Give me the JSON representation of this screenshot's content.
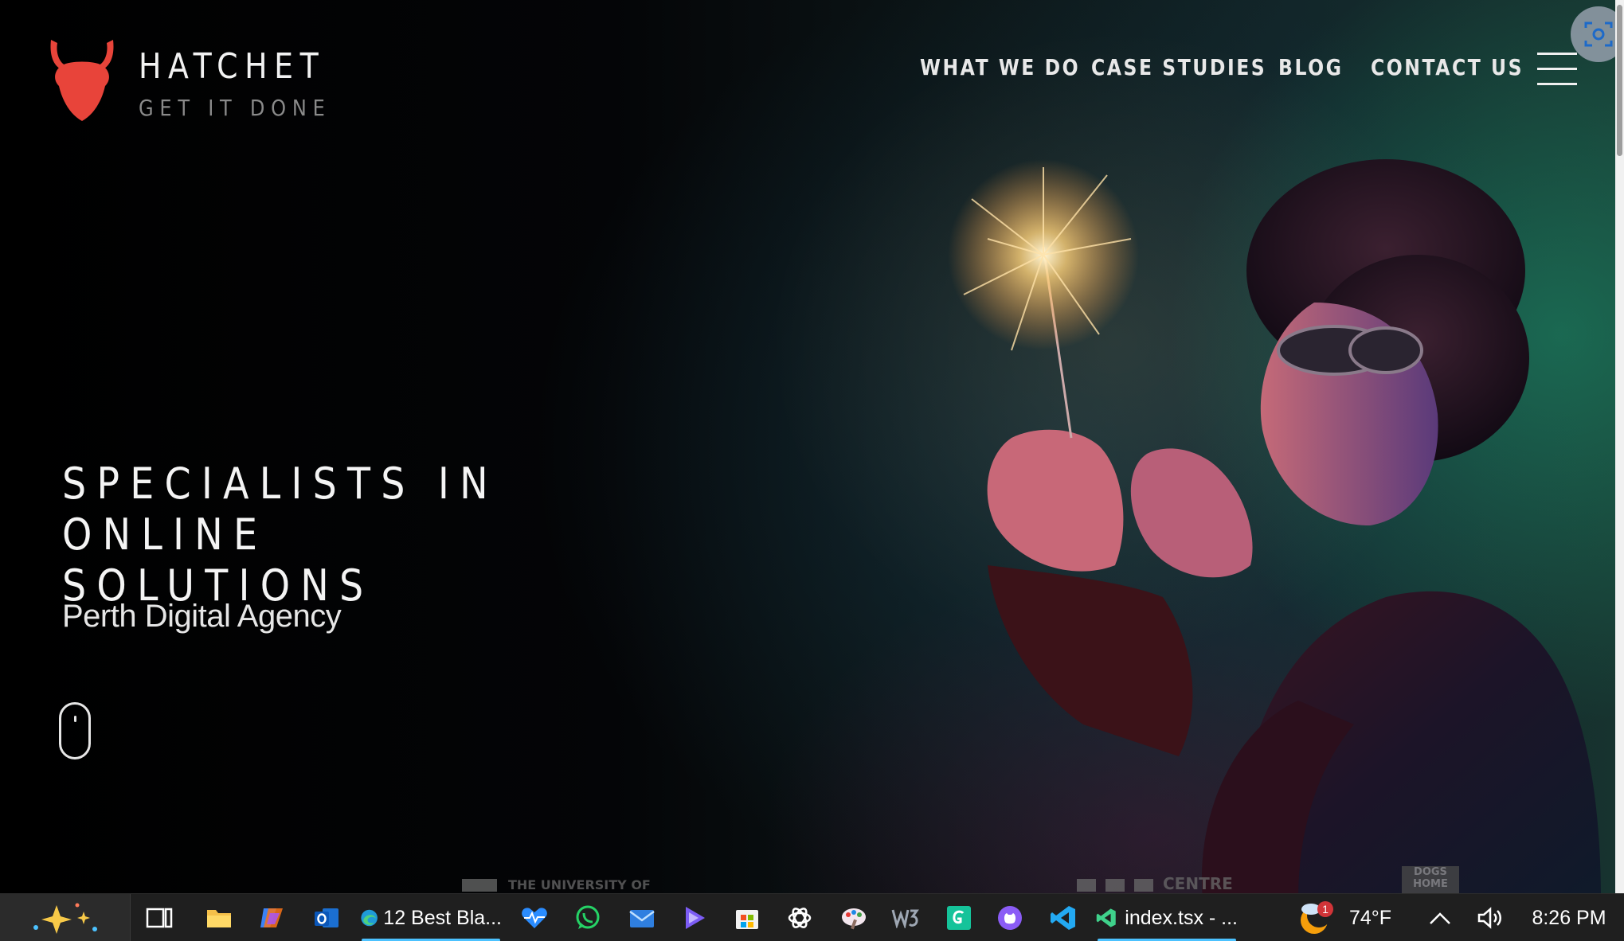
{
  "site": {
    "brand_name": "HATCHET",
    "tagline": "GET IT DONE",
    "accent_color": "#e8443a",
    "nav": [
      {
        "label": "WHAT WE DO"
      },
      {
        "label": "CASE STUDIES"
      },
      {
        "label": "BLOG"
      },
      {
        "label": "CONTACT US"
      }
    ],
    "menu_icon": "hamburger-icon",
    "capture_icon": "screen-capture-icon",
    "hero": {
      "headline_line1": "SPECIALISTS IN ONLINE",
      "headline_line2": "SOLUTIONS",
      "subheadline": "Perth Digital Agency",
      "scroll_icon": "mouse-scroll-icon"
    },
    "clients": [
      "THE UNIVERSITY OF",
      "CENTRE",
      "DOGS",
      "HOME"
    ]
  },
  "taskbar": {
    "apps": [
      {
        "name": "copilot",
        "icon": "sparkle-icon"
      },
      {
        "name": "task-view",
        "icon": "task-view-icon"
      },
      {
        "name": "file-explorer",
        "icon": "folder-icon"
      },
      {
        "name": "copilot-app",
        "icon": "copilot-icon"
      },
      {
        "name": "outlook",
        "icon": "outlook-icon"
      },
      {
        "name": "edge",
        "icon": "edge-icon",
        "label": "12 Best Bla..."
      },
      {
        "name": "health",
        "icon": "heart-pulse-icon"
      },
      {
        "name": "whatsapp",
        "icon": "whatsapp-icon"
      },
      {
        "name": "mail",
        "icon": "mail-icon"
      },
      {
        "name": "media",
        "icon": "play-icon"
      },
      {
        "name": "store",
        "icon": "store-icon"
      },
      {
        "name": "chatgpt",
        "icon": "chatgpt-icon"
      },
      {
        "name": "paint",
        "icon": "paint-icon"
      },
      {
        "name": "w3",
        "icon": "w3-icon"
      },
      {
        "name": "grammarly",
        "icon": "grammarly-icon"
      },
      {
        "name": "github",
        "icon": "github-icon"
      },
      {
        "name": "vscode",
        "icon": "vscode-icon"
      },
      {
        "name": "vscode-window",
        "icon": "vscode-icon",
        "label": "index.tsx - ..."
      }
    ],
    "weather": {
      "temp": "74°F",
      "badge": "1",
      "icon": "weather-icon"
    },
    "tray": {
      "chevron_icon": "chevron-up-icon",
      "volume_icon": "speaker-icon"
    },
    "time": "8:26 PM"
  }
}
